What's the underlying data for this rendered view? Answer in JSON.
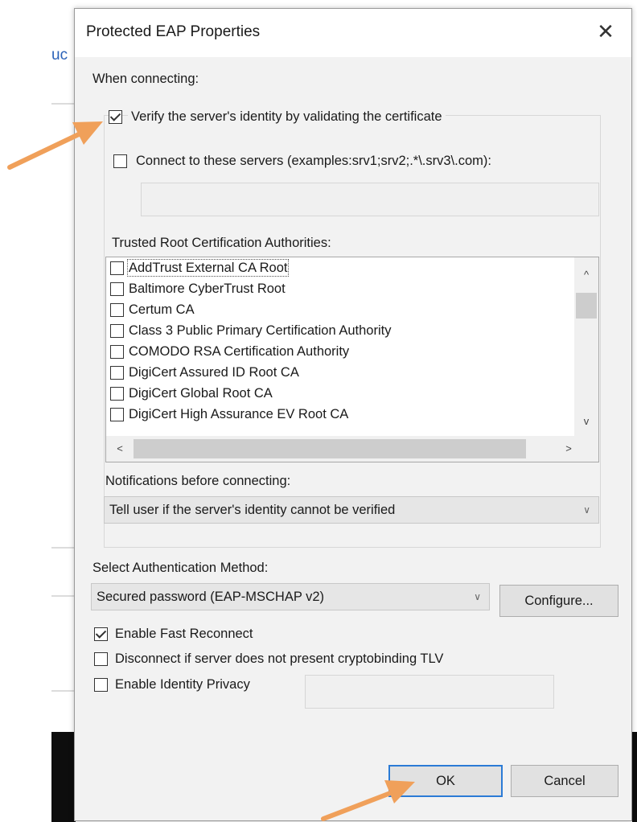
{
  "background": {
    "partial_text": "uc"
  },
  "dialog": {
    "title": "Protected EAP Properties",
    "close_glyph": "✕",
    "when_connecting_label": "When connecting:",
    "verify_server": {
      "label": "Verify the server's identity by validating the certificate",
      "checked": true
    },
    "connect_servers": {
      "label": "Connect to these servers (examples:srv1;srv2;.*\\.srv3\\.com):",
      "checked": false,
      "value": ""
    },
    "trusted_root_label": "Trusted Root Certification Authorities:",
    "cas": [
      {
        "label": "AddTrust External CA Root",
        "checked": false
      },
      {
        "label": "Baltimore CyberTrust Root",
        "checked": false
      },
      {
        "label": "Certum CA",
        "checked": false
      },
      {
        "label": "Class 3 Public Primary Certification Authority",
        "checked": false
      },
      {
        "label": "COMODO RSA Certification Authority",
        "checked": false
      },
      {
        "label": "DigiCert Assured ID Root CA",
        "checked": false
      },
      {
        "label": "DigiCert Global Root CA",
        "checked": false
      },
      {
        "label": "DigiCert High Assurance EV Root CA",
        "checked": false
      }
    ],
    "scroll": {
      "up": "^",
      "down": "v",
      "left": "<",
      "right": ">"
    },
    "notifications_label": "Notifications before connecting:",
    "notifications_value": "Tell user if the server's identity cannot be verified",
    "auth_method_label": "Select Authentication Method:",
    "auth_method_value": "Secured password (EAP-MSCHAP v2)",
    "configure_label": "Configure...",
    "fast_reconnect": {
      "label": "Enable Fast Reconnect",
      "checked": true
    },
    "disconnect_crypto": {
      "label": "Disconnect if server does not present cryptobinding TLV",
      "checked": false
    },
    "identity_privacy": {
      "label": "Enable Identity Privacy",
      "checked": false,
      "value": ""
    },
    "ok_label": "OK",
    "cancel_label": "Cancel"
  },
  "colors": {
    "accent": "#2b7bd6",
    "annotation_arrow": "#f0a05a"
  }
}
